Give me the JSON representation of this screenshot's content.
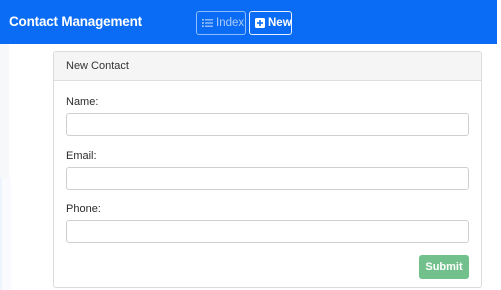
{
  "navbar": {
    "brand": "Contact Management",
    "color": "#0a6cf5",
    "buttons": [
      {
        "label": "Index",
        "icon": "list-icon"
      },
      {
        "label": "New",
        "icon": "plus-square-icon"
      }
    ]
  },
  "card": {
    "title": "New Contact",
    "fields": [
      {
        "label": "Name:",
        "value": "",
        "placeholder": ""
      },
      {
        "label": "Email:",
        "value": "",
        "placeholder": ""
      },
      {
        "label": "Phone:",
        "value": "",
        "placeholder": ""
      }
    ],
    "submit_label": "Submit",
    "submit_color": "#72c08b"
  }
}
